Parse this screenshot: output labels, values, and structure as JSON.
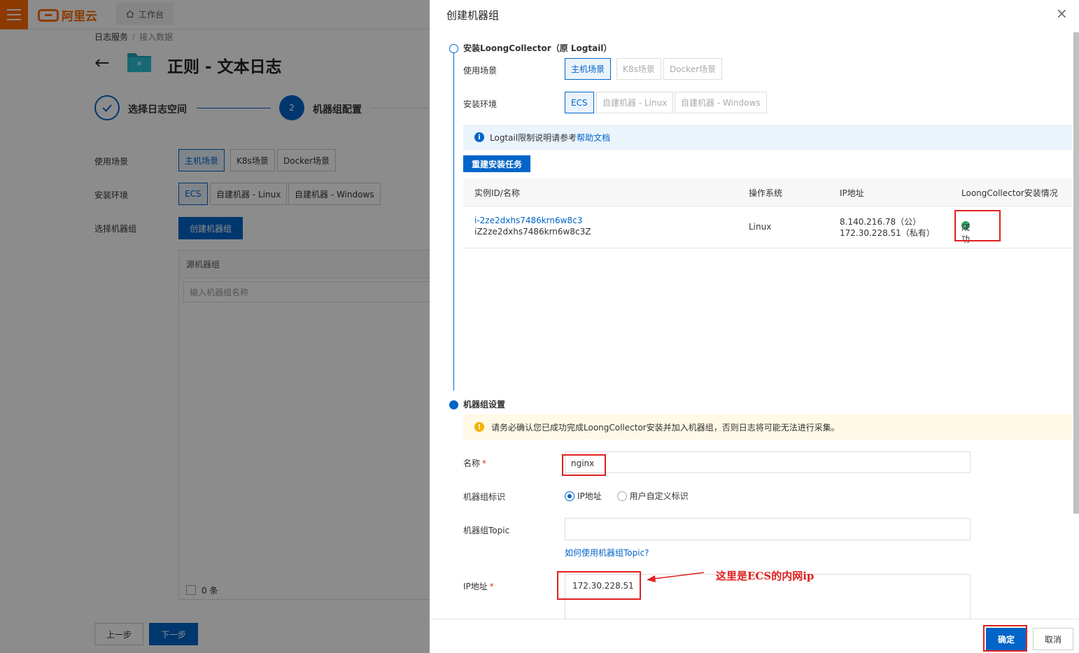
{
  "topbar": {
    "brand": "阿里云",
    "workbench": "工作台"
  },
  "breadcrumb": {
    "root": "日志服务",
    "sep": "/",
    "current": "接入数据"
  },
  "page": {
    "title": "正则 - 文本日志"
  },
  "steps": [
    {
      "label": "选择日志空间"
    },
    {
      "number": "2",
      "label": "机器组配置"
    }
  ],
  "bg_form": {
    "scene_label": "使用场景",
    "scene_options": [
      "主机场景",
      "K8s场景",
      "Docker场景"
    ],
    "env_label": "安装环境",
    "env_options": [
      "ECS",
      "自建机器 - Linux",
      "自建机器 - Windows"
    ],
    "group_label": "选择机器组",
    "create_group_button": "创建机器组",
    "source_group_header": "源机器组",
    "search_placeholder": "输入机器组名称",
    "count_text": "0 条",
    "prev_button": "上一步",
    "next_button": "下一步"
  },
  "drawer": {
    "title": "创建机器组",
    "close": "×",
    "section_install": "安装LoongCollector（原 Logtail）",
    "scene_label": "使用场景",
    "scene_options": [
      "主机场景",
      "K8s场景",
      "Docker场景"
    ],
    "env_label": "安装环境",
    "env_options": [
      "ECS",
      "自建机器 - Linux",
      "自建机器 - Windows"
    ],
    "info_text": "Logtail限制说明请参考",
    "info_link": "帮助文档",
    "reinstall_button": "重建安装任务",
    "table": {
      "headers": [
        "实例ID/名称",
        "操作系统",
        "IP地址",
        "LoongCollector安装情况"
      ],
      "row": {
        "instance_id": "i-2ze2dxhs7486krn6w8c3",
        "instance_name": "iZ2ze2dxhs7486krn6w8c3Z",
        "os": "Linux",
        "public_ip": "8.140.216.78（公）",
        "private_ip": "172.30.228.51（私有）",
        "status": "成功"
      }
    },
    "section_group": "机器组设置",
    "warning": "请务必确认您已成功完成LoongCollector安装并加入机器组，否则日志将可能无法进行采集。",
    "name_label": "名称",
    "required_mark": "*",
    "name_value": "nginx",
    "identifier_label": "机器组标识",
    "identifier_options": [
      "IP地址",
      "用户自定义标识"
    ],
    "topic_label": "机器组Topic",
    "topic_value": "",
    "topic_help": "如何使用机器组Topic?",
    "ip_label": "IP地址",
    "ip_value": "172.30.228.51",
    "annotation": "这里是ECS的内网ip",
    "ok_button": "确定",
    "cancel_button": "取消"
  },
  "colors": {
    "primary": "#0064c8",
    "brand": "#ff6a00",
    "highlight": "#e02020",
    "success": "#23a55a"
  }
}
